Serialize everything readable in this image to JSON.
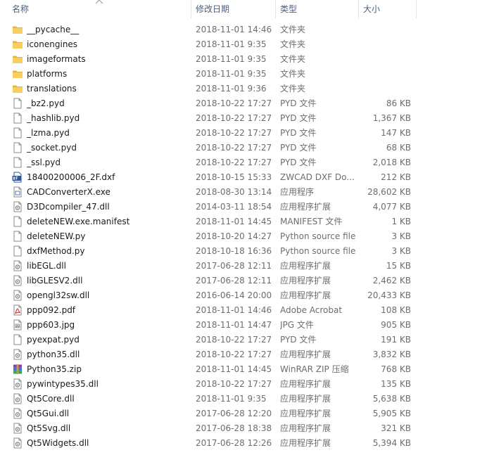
{
  "columns": {
    "name": "名称",
    "date": "修改日期",
    "type": "类型",
    "size": "大小"
  },
  "colors": {
    "header_text": "#4c607a",
    "name_text": "#1a1a1a",
    "meta_text": "#6d6d6d",
    "folder": "#f2c14e"
  },
  "files": [
    {
      "name": "__pycache__",
      "date": "2018-11-01 14:46",
      "type": "文件夹",
      "size": "",
      "icon": "folder-icon"
    },
    {
      "name": "iconengines",
      "date": "2018-11-01 9:35",
      "type": "文件夹",
      "size": "",
      "icon": "folder-icon"
    },
    {
      "name": "imageformats",
      "date": "2018-11-01 9:35",
      "type": "文件夹",
      "size": "",
      "icon": "folder-icon"
    },
    {
      "name": "platforms",
      "date": "2018-11-01 9:35",
      "type": "文件夹",
      "size": "",
      "icon": "folder-icon"
    },
    {
      "name": "translations",
      "date": "2018-11-01 9:36",
      "type": "文件夹",
      "size": "",
      "icon": "folder-icon"
    },
    {
      "name": "_bz2.pyd",
      "date": "2018-10-22 17:27",
      "type": "PYD 文件",
      "size": "86 KB",
      "icon": "file-icon"
    },
    {
      "name": "_hashlib.pyd",
      "date": "2018-10-22 17:27",
      "type": "PYD 文件",
      "size": "1,367 KB",
      "icon": "file-icon"
    },
    {
      "name": "_lzma.pyd",
      "date": "2018-10-22 17:27",
      "type": "PYD 文件",
      "size": "147 KB",
      "icon": "file-icon"
    },
    {
      "name": "_socket.pyd",
      "date": "2018-10-22 17:27",
      "type": "PYD 文件",
      "size": "68 KB",
      "icon": "file-icon"
    },
    {
      "name": "_ssl.pyd",
      "date": "2018-10-22 17:27",
      "type": "PYD 文件",
      "size": "2,018 KB",
      "icon": "file-icon"
    },
    {
      "name": "18400200006_2F.dxf",
      "date": "2018-10-15 15:33",
      "type": "ZWCAD DXF Do...",
      "size": "212 KB",
      "icon": "dxf-file-icon"
    },
    {
      "name": "CADConverterX.exe",
      "date": "2018-08-30 13:14",
      "type": "应用程序",
      "size": "28,602 KB",
      "icon": "exe-icon"
    },
    {
      "name": "D3Dcompiler_47.dll",
      "date": "2014-03-11 18:54",
      "type": "应用程序扩展",
      "size": "4,077 KB",
      "icon": "dll-icon"
    },
    {
      "name": "deleteNEW.exe.manifest",
      "date": "2018-11-01 14:45",
      "type": "MANIFEST 文件",
      "size": "1 KB",
      "icon": "file-icon"
    },
    {
      "name": "deleteNEW.py",
      "date": "2018-10-20 14:27",
      "type": "Python source file",
      "size": "3 KB",
      "icon": "file-icon"
    },
    {
      "name": "dxfMethod.py",
      "date": "2018-10-18 16:36",
      "type": "Python source file",
      "size": "3 KB",
      "icon": "file-icon"
    },
    {
      "name": "libEGL.dll",
      "date": "2017-06-28 12:11",
      "type": "应用程序扩展",
      "size": "15 KB",
      "icon": "dll-icon"
    },
    {
      "name": "libGLESV2.dll",
      "date": "2017-06-28 12:11",
      "type": "应用程序扩展",
      "size": "2,462 KB",
      "icon": "dll-icon"
    },
    {
      "name": "opengl32sw.dll",
      "date": "2016-06-14 20:00",
      "type": "应用程序扩展",
      "size": "20,433 KB",
      "icon": "dll-icon"
    },
    {
      "name": "ppp092.pdf",
      "date": "2018-11-01 14:46",
      "type": "Adobe Acrobat",
      "size": "108 KB",
      "icon": "pdf-icon"
    },
    {
      "name": "ppp603.jpg",
      "date": "2018-11-01 14:47",
      "type": "JPG 文件",
      "size": "905 KB",
      "icon": "image-icon"
    },
    {
      "name": "pyexpat.pyd",
      "date": "2018-10-22 17:27",
      "type": "PYD 文件",
      "size": "191 KB",
      "icon": "file-icon"
    },
    {
      "name": "python35.dll",
      "date": "2018-10-22 17:27",
      "type": "应用程序扩展",
      "size": "3,832 KB",
      "icon": "dll-icon"
    },
    {
      "name": "Python35.zip",
      "date": "2018-11-01 14:45",
      "type": "WinRAR ZIP 压缩",
      "size": "768 KB",
      "icon": "winrar-zip-icon"
    },
    {
      "name": "pywintypes35.dll",
      "date": "2018-10-22 17:27",
      "type": "应用程序扩展",
      "size": "135 KB",
      "icon": "dll-icon"
    },
    {
      "name": "Qt5Core.dll",
      "date": "2018-11-01 9:35",
      "type": "应用程序扩展",
      "size": "5,638 KB",
      "icon": "dll-icon"
    },
    {
      "name": "Qt5Gui.dll",
      "date": "2017-06-28 12:20",
      "type": "应用程序扩展",
      "size": "5,905 KB",
      "icon": "dll-icon"
    },
    {
      "name": "Qt5Svg.dll",
      "date": "2017-06-28 18:38",
      "type": "应用程序扩展",
      "size": "321 KB",
      "icon": "dll-icon"
    },
    {
      "name": "Qt5Widgets.dll",
      "date": "2017-06-28 12:26",
      "type": "应用程序扩展",
      "size": "5,394 KB",
      "icon": "dll-icon"
    }
  ]
}
